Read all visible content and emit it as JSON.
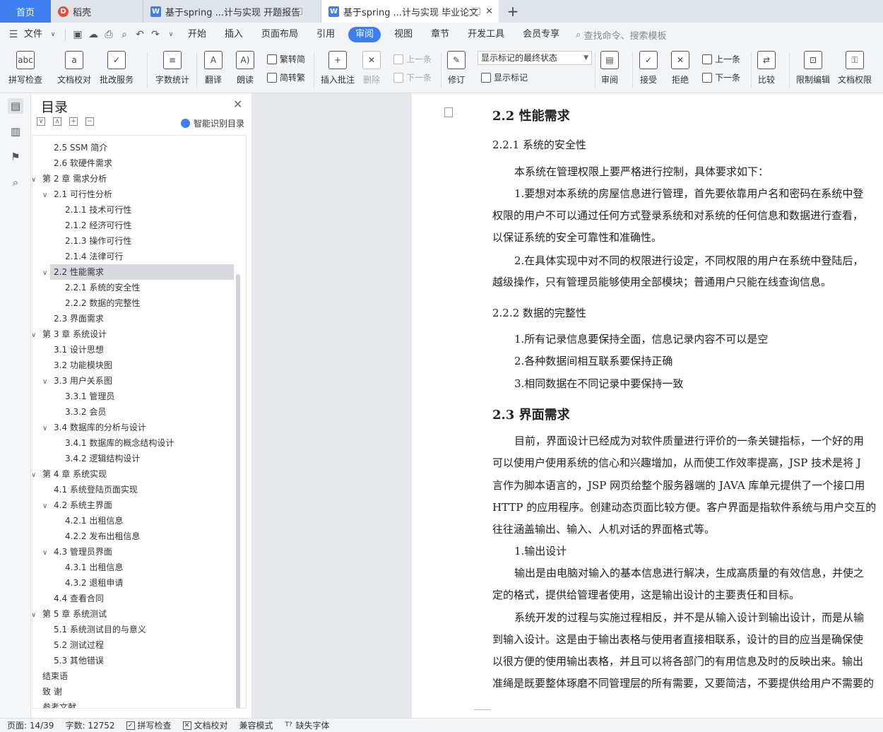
{
  "tabs": [
    {
      "label": "首页"
    },
    {
      "label": "稻壳"
    },
    {
      "label": "基于spring ...计与实现 开题报告"
    },
    {
      "label": "基于spring ...计与实现 毕业论文"
    }
  ],
  "menu": {
    "file": "文件",
    "items": [
      "开始",
      "插入",
      "页面布局",
      "引用",
      "审阅",
      "视图",
      "章节",
      "开发工具",
      "会员专享"
    ],
    "search": "查找命令、搜索模板"
  },
  "ribbon": {
    "spell_check": "拼写检查",
    "doc_proof": "文档校对",
    "batch_service": "批改服务",
    "word_count": "字数统计",
    "translate": "翻译",
    "read_aloud": "朗读",
    "to_traditional": "繁转简",
    "to_simplified": "简转繁",
    "insert_comment": "插入批注",
    "delete": "删除",
    "prev_comment": "上一条",
    "next_comment": "下一条",
    "revise": "修订",
    "markup_dropdown": "显示标记的最终状态",
    "show_markup": "显示标记",
    "review": "审阅",
    "accept": "接受",
    "reject": "拒绝",
    "prev_change": "上一条",
    "next_change": "下一条",
    "compare": "比较",
    "restrict_edit": "限制编辑",
    "doc_permission": "文档权限"
  },
  "toc": {
    "title": "目录",
    "smart_label": "智能识别目录",
    "items": [
      {
        "text": "2.5 SSM 简介",
        "level": 2,
        "caret": ""
      },
      {
        "text": "2.6 软硬件需求",
        "level": 2,
        "caret": ""
      },
      {
        "text": "第 2 章  需求分析",
        "level": 1,
        "caret": "v"
      },
      {
        "text": "2.1  可行性分析",
        "level": 2,
        "caret": "v"
      },
      {
        "text": "2.1.1  技术可行性",
        "level": 3,
        "caret": ""
      },
      {
        "text": "2.1.2  经济可行性",
        "level": 3,
        "caret": ""
      },
      {
        "text": "2.1.3  操作可行性",
        "level": 3,
        "caret": ""
      },
      {
        "text": "2.1.4  法律可行",
        "level": 3,
        "caret": ""
      },
      {
        "text": "2.2 性能需求",
        "level": 2,
        "caret": "v"
      },
      {
        "text": "2.2.1 系统的安全性",
        "level": 3,
        "caret": ""
      },
      {
        "text": "2.2.2 数据的完整性",
        "level": 3,
        "caret": ""
      },
      {
        "text": "2.3 界面需求",
        "level": 2,
        "caret": ""
      },
      {
        "text": "第 3 章  系统设计",
        "level": 1,
        "caret": "v"
      },
      {
        "text": "3.1 设计思想",
        "level": 2,
        "caret": ""
      },
      {
        "text": "3.2 功能模块图",
        "level": 2,
        "caret": ""
      },
      {
        "text": "3.3 用户关系图",
        "level": 2,
        "caret": "v"
      },
      {
        "text": "3.3.1 管理员",
        "level": 3,
        "caret": ""
      },
      {
        "text": "3.3.2 会员",
        "level": 3,
        "caret": ""
      },
      {
        "text": "3.4 数据库的分析与设计",
        "level": 2,
        "caret": "v"
      },
      {
        "text": "3.4.1 数据库的概念结构设计",
        "level": 3,
        "caret": ""
      },
      {
        "text": "3.4.2 逻辑结构设计",
        "level": 3,
        "caret": ""
      },
      {
        "text": "第 4 章  系统实现",
        "level": 1,
        "caret": "v"
      },
      {
        "text": "4.1  系统登陆页面实现",
        "level": 2,
        "caret": ""
      },
      {
        "text": "4.2  系统主界面",
        "level": 2,
        "caret": "v"
      },
      {
        "text": "4.2.1  出租信息",
        "level": 3,
        "caret": ""
      },
      {
        "text": "4.2.2  发布出租信息",
        "level": 3,
        "caret": ""
      },
      {
        "text": "4.3  管理员界面",
        "level": 2,
        "caret": "v"
      },
      {
        "text": "4.3.1  出租信息",
        "level": 3,
        "caret": ""
      },
      {
        "text": "4.3.2  退租申请",
        "level": 3,
        "caret": ""
      },
      {
        "text": "4.4  查看合同",
        "level": 2,
        "caret": ""
      },
      {
        "text": "第 5 章  系统测试",
        "level": 1,
        "caret": "v"
      },
      {
        "text": "5.1  系统测试目的与意义",
        "level": 2,
        "caret": ""
      },
      {
        "text": "5.2  测试过程",
        "level": 2,
        "caret": ""
      },
      {
        "text": "5.3  其他错误",
        "level": 2,
        "caret": ""
      },
      {
        "text": "结束语",
        "level": 1,
        "caret": ""
      },
      {
        "text": "致    谢",
        "level": 1,
        "caret": ""
      },
      {
        "text": "参考文献",
        "level": 1,
        "caret": ""
      }
    ]
  },
  "document": {
    "lines": [
      {
        "text": "2.2 性能需求",
        "style": "h2"
      },
      {
        "text": "2.2.1 系统的安全性",
        "style": "h3"
      },
      {
        "text": "本系统在管理权限上要严格进行控制，具体要求如下：",
        "style": "ind"
      },
      {
        "text": "1.要想对本系统的房屋信息进行管理，首先要依靠用户名和密码在系统中登",
        "style": "ind"
      },
      {
        "text": "权限的用户不可以通过任何方式登录系统和对系统的任何信息和数据进行查看，",
        "style": "p"
      },
      {
        "text": "以保证系统的安全可靠性和准确性。",
        "style": "p"
      },
      {
        "text": "2.在具体实现中对不同的权限进行设定，不同权限的用户在系统中登陆后，",
        "style": "ind"
      },
      {
        "text": "越级操作，只有管理员能够使用全部模块；普通用户只能在线查询信息。",
        "style": "p"
      },
      {
        "text": "2.2.2 数据的完整性",
        "style": "h3"
      },
      {
        "text": "1.所有记录信息要保持全面，信息记录内容不可以是空",
        "style": "ind"
      },
      {
        "text": "2.各种数据间相互联系要保持正确",
        "style": "ind"
      },
      {
        "text": "3.相同数据在不同记录中要保持一致",
        "style": "ind"
      },
      {
        "text": "2.3 界面需求",
        "style": "h2"
      },
      {
        "text": "目前，界面设计已经成为对软件质量进行评价的一条关键指标，一个好的用",
        "style": "ind"
      },
      {
        "text": "可以使用户使用系统的信心和兴趣增加，从而使工作效率提高，JSP 技术是将 J",
        "style": "p"
      },
      {
        "text": "言作为脚本语言的，JSP 网页给整个服务器端的 JAVA 库单元提供了一个接口用",
        "style": "p"
      },
      {
        "text": "HTTP 的应用程序。创建动态页面比较方便。客户界面是指软件系统与用户交互的",
        "style": "p"
      },
      {
        "text": "往往涵盖输出、输入、人机对话的界面格式等。",
        "style": "p"
      },
      {
        "text": "1.输出设计",
        "style": "ind"
      },
      {
        "text": "输出是由电脑对输入的基本信息进行解决，生成高质量的有效信息，并使之",
        "style": "ind"
      },
      {
        "text": "定的格式，提供给管理者使用，这是输出设计的主要责任和目标。",
        "style": "p"
      },
      {
        "text": "系统开发的过程与实施过程相反，并不是从输入设计到输出设计，而是从输",
        "style": "ind"
      },
      {
        "text": "到输入设计。这是由于输出表格与使用者直接相联系，设计的目的应当是确保使",
        "style": "p"
      },
      {
        "text": "以很方便的使用输出表格，并且可以将各部门的有用信息及时的反映出来。输出",
        "style": "p"
      },
      {
        "text": "准绳是既要整体琢磨不同管理层的所有需要，又要简洁，不要提供给用户不需要的",
        "style": "p"
      }
    ]
  },
  "status": {
    "page": "页面: 14/39",
    "words": "字数: 12752",
    "spell": "拼写检查",
    "proof": "文档校对",
    "compat": "兼容模式",
    "missing_font": "缺失字体"
  }
}
